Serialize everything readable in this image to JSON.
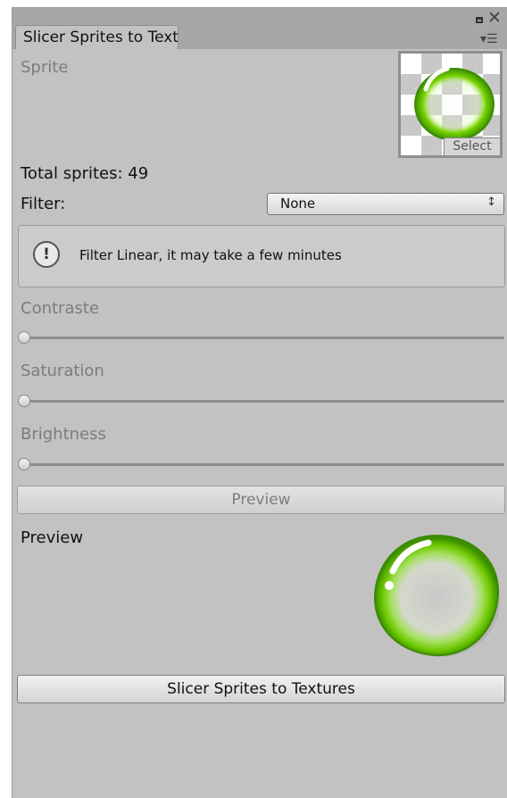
{
  "window": {
    "tab_title": "Slicer Sprites to Textures",
    "controls": {
      "maximize_icon": "maximize-icon",
      "close_icon": "close-icon",
      "menu_icon": "menu-icon"
    }
  },
  "sprite": {
    "label": "Sprite",
    "select_label": "Select"
  },
  "stats": {
    "total_sprites": "Total sprites: 49"
  },
  "filter": {
    "label": "Filter:",
    "selected": "None",
    "arrow_glyph": "↕"
  },
  "help": {
    "icon": "info-icon",
    "glyph": "!",
    "message": "Filter Linear, it may take a few minutes"
  },
  "sliders": {
    "contrast": {
      "label": "Contraste",
      "value": 0
    },
    "saturation": {
      "label": "Saturation",
      "value": 0
    },
    "brightness": {
      "label": "Brightness",
      "value": 0
    }
  },
  "buttons": {
    "preview": "Preview",
    "slicer": "Slicer Sprites to Textures"
  },
  "preview": {
    "label": "Preview"
  },
  "colors": {
    "panel_bg": "#c2c2c2",
    "tabbar_bg": "#a7a7a7",
    "bubble_green": "#5fc400"
  }
}
